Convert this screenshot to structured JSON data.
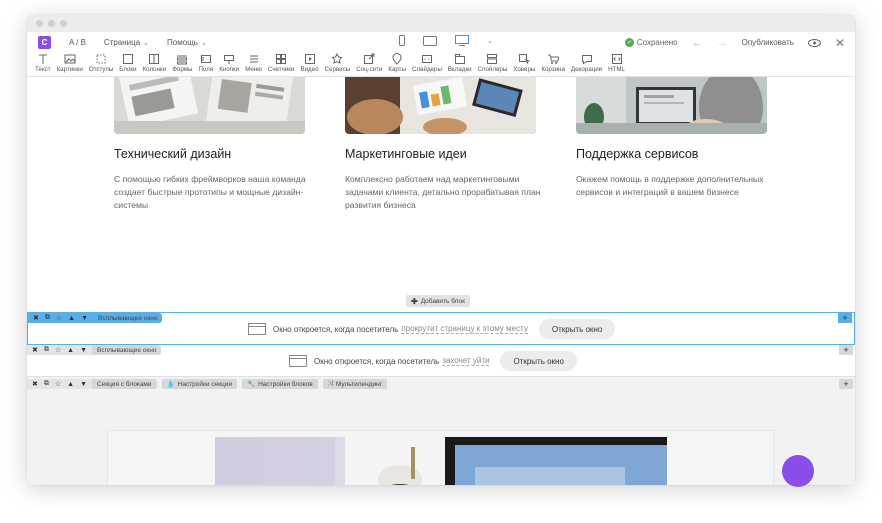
{
  "topbar": {
    "logo": "C",
    "ab": "A / B",
    "page": "Страница",
    "help": "Помощь",
    "saved": "Сохранено",
    "publish": "Опубликовать"
  },
  "toolbar": [
    {
      "name": "text",
      "label": "Текст"
    },
    {
      "name": "images",
      "label": "Картинки"
    },
    {
      "name": "spacing",
      "label": "Отступы"
    },
    {
      "name": "blocks",
      "label": "Блоки"
    },
    {
      "name": "columns",
      "label": "Колонки"
    },
    {
      "name": "forms",
      "label": "Формы"
    },
    {
      "name": "fields",
      "label": "Поля"
    },
    {
      "name": "buttons",
      "label": "Кнопки"
    },
    {
      "name": "menu",
      "label": "Меню"
    },
    {
      "name": "counters",
      "label": "Счетчики"
    },
    {
      "name": "video",
      "label": "Видео"
    },
    {
      "name": "services",
      "label": "Сервисы"
    },
    {
      "name": "social",
      "label": "Соц-сети"
    },
    {
      "name": "maps",
      "label": "Карты"
    },
    {
      "name": "sliders",
      "label": "Слайдеры"
    },
    {
      "name": "tabs",
      "label": "Вкладки"
    },
    {
      "name": "spoilers",
      "label": "Спойлеры"
    },
    {
      "name": "hovers",
      "label": "Ховеры"
    },
    {
      "name": "cart",
      "label": "Корзина"
    },
    {
      "name": "decorations",
      "label": "Декорации"
    },
    {
      "name": "html",
      "label": "HTML"
    }
  ],
  "cards": [
    {
      "title": "Технический дизайн",
      "text": "С помощью гибких фреймворков наша команда создает быстрые прототипы и мощные дизайн-системы"
    },
    {
      "title": "Маркетинговые идеи",
      "text": "Комплексно работаем над маркетинговыми задачами клиента, детально прорабатывая план развития бизнеса"
    },
    {
      "title": "Поддержка сервисов",
      "text": "Окажем помощь в поддержке дополнительных сервисов и интеграций в вашем бизнесе"
    }
  ],
  "add_block": "Добавить блок",
  "popup1": {
    "chip": "Всплывающее окно",
    "text": "Окно откроется, когда посетитель",
    "link": "прокрутит страницу к этому месту",
    "button": "Открыть окно"
  },
  "popup2": {
    "chip": "Всплывающее окно",
    "text": "Окно откроется, когда посетитель",
    "link": "захочет уйти",
    "button": "Открыть окно"
  },
  "section": {
    "chip": "Секция с блоками",
    "settings": "Настройки секции",
    "block_settings": "Настройки блоков",
    "multilanding": "Мультилендинг"
  },
  "colors": {
    "accent": "#8a4de8",
    "selection": "#5aaee8",
    "saved": "#4caf50"
  }
}
